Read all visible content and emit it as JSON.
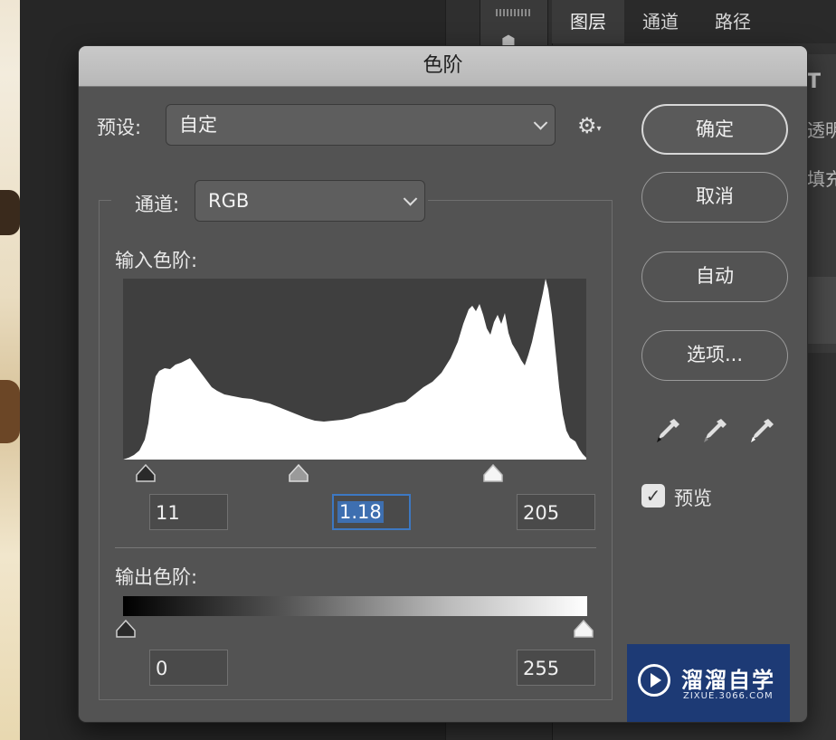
{
  "background_panel": {
    "tabs": [
      "图层",
      "通道",
      "路径"
    ],
    "side_glyph": "T",
    "side_text_1": "透明度",
    "side_text_2": "填充"
  },
  "dialog": {
    "title": "色阶",
    "preset_label": "预设:",
    "preset_value": "自定",
    "channel_label": "通道:",
    "channel_value": "RGB",
    "input_levels_label": "输入色阶:",
    "output_levels_label": "输出色阶:",
    "input_black": "11",
    "input_gamma": "1.18",
    "input_white": "205",
    "output_black": "0",
    "output_white": "255",
    "buttons": {
      "ok": "确定",
      "cancel": "取消",
      "auto": "自动",
      "options": "选项..."
    },
    "preview_label": "预览",
    "preview_checked": true,
    "icons": [
      "settings-gear-icon",
      "black-eyedropper-icon",
      "gray-eyedropper-icon",
      "white-eyedropper-icon",
      "checkmark-icon",
      "chevron-down-icon"
    ]
  },
  "watermark": {
    "title": "溜溜自学",
    "subtitle": "ZIXUE.3066.COM"
  },
  "colors": {
    "dialog_bg": "#535353",
    "titlebar": "#c4c4c4",
    "focus_blue": "#3d78c2",
    "watermark_bg": "#1d3a75"
  }
}
